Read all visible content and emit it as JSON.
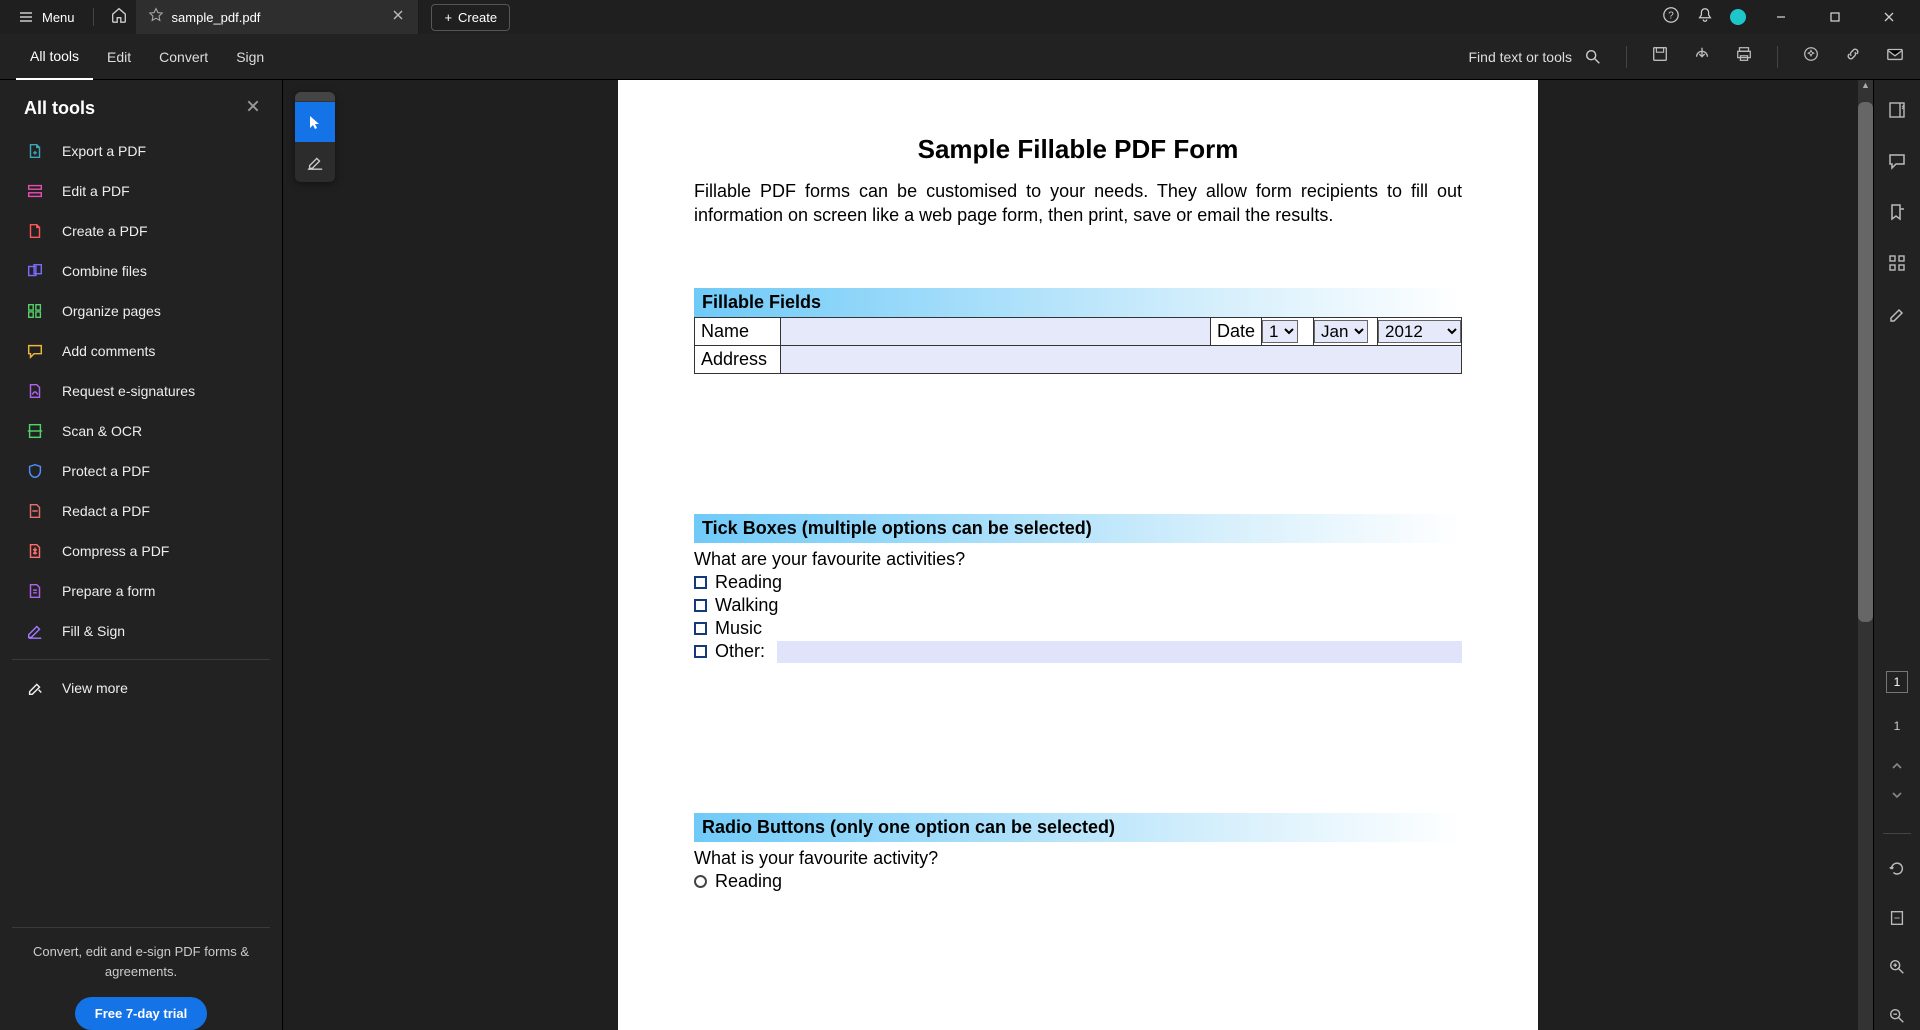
{
  "titlebar": {
    "menu": "Menu",
    "filename": "sample_pdf.pdf",
    "create": "Create"
  },
  "toolbar": {
    "tabs": [
      "All tools",
      "Edit",
      "Convert",
      "Sign"
    ],
    "find": "Find text or tools"
  },
  "sidebar": {
    "title": "All tools",
    "items": [
      {
        "icon": "export",
        "label": "Export a PDF",
        "color": "#3aa6b9"
      },
      {
        "icon": "edit",
        "label": "Edit a PDF",
        "color": "#e34db1"
      },
      {
        "icon": "create",
        "label": "Create a PDF",
        "color": "#ff5656"
      },
      {
        "icon": "combine",
        "label": "Combine files",
        "color": "#7a6bff"
      },
      {
        "icon": "organize",
        "label": "Organize pages",
        "color": "#57d46b"
      },
      {
        "icon": "comments",
        "label": "Add comments",
        "color": "#f0b63a"
      },
      {
        "icon": "esign",
        "label": "Request e-signatures",
        "color": "#b162f0"
      },
      {
        "icon": "scan",
        "label": "Scan & OCR",
        "color": "#4fd46b"
      },
      {
        "icon": "protect",
        "label": "Protect a PDF",
        "color": "#4f8fff"
      },
      {
        "icon": "redact",
        "label": "Redact a PDF",
        "color": "#e66e6e"
      },
      {
        "icon": "compress",
        "label": "Compress a PDF",
        "color": "#ff6e6e"
      },
      {
        "icon": "prepare",
        "label": "Prepare a form",
        "color": "#b162f0"
      },
      {
        "icon": "fillsign",
        "label": "Fill & Sign",
        "color": "#a378ff"
      },
      {
        "icon": "more",
        "label": "View more",
        "color": "#eee"
      }
    ],
    "promo": "Convert, edit and e-sign PDF forms & agreements.",
    "trial": "Free 7-day trial"
  },
  "doc": {
    "title": "Sample Fillable PDF Form",
    "intro": "Fillable PDF forms can be customised to your needs. They allow form recipients to fill out information on screen like a web page form, then print, save or email the results.",
    "sec1": "Fillable Fields",
    "name_lbl": "Name",
    "date_lbl": "Date",
    "day": "1",
    "month": "Jan",
    "year": "2012",
    "addr_lbl": "Address",
    "sec2": "Tick Boxes (multiple options can be selected)",
    "q2": "What are your favourite activities?",
    "opts2": [
      "Reading",
      "Walking",
      "Music",
      "Other:"
    ],
    "sec3": "Radio Buttons (only one option can be selected)",
    "q3": "What is your favourite activity?",
    "opts3": [
      "Reading"
    ]
  },
  "rail": {
    "page": "1",
    "total": "1"
  }
}
